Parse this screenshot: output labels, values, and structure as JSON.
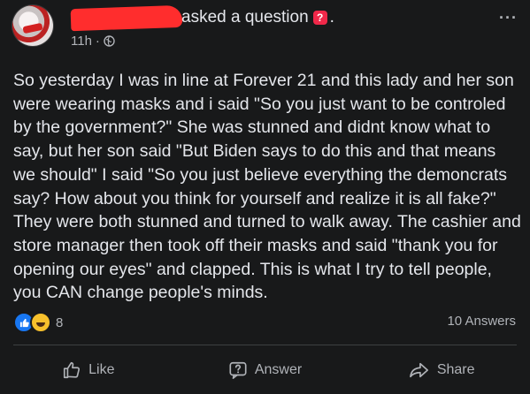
{
  "header": {
    "action_text": "asked a question",
    "question_badge": "?",
    "trailing_dot": ".",
    "time": "11h",
    "separator": "·",
    "more_menu": "···"
  },
  "post": {
    "body": "So yesterday I was in line at Forever 21 and this lady and her son were wearing masks and i said \"So you just want to be controled by the government?\" She was stunned and didnt know what to say, but her son said \"But Biden says to do this and that means we should\" I said \"So you just believe everything the demoncrats say? How about you think for yourself and realize it is all fake?\" They were both stunned and turned to walk away. The cashier and store manager then took off their masks and said \"thank you for opening our eyes\" and clapped. This is what I try to tell people, you CAN change people's minds."
  },
  "stats": {
    "reaction_count": "8",
    "answers_count": "10 Answers"
  },
  "actions": {
    "like_label": "Like",
    "answer_label": "Answer",
    "share_label": "Share"
  },
  "colors": {
    "background": "#18191a",
    "text": "#e4e6eb",
    "secondary_text": "#b0b3b8",
    "like_blue": "#1877f2",
    "haha_yellow": "#f7c02c",
    "question_badge_red": "#f02849",
    "redaction_red": "#ff2d2d"
  }
}
